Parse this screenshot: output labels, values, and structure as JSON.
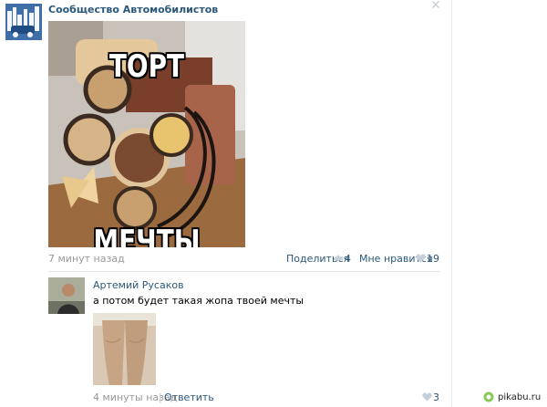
{
  "post": {
    "group_name": "Сообщество Автомобилистов",
    "close_glyph": "✕",
    "meme_top": "ТОРТ",
    "meme_bottom": "МЕЧТЫ",
    "timestamp": "7 минут назад",
    "share_label": "Поделиться",
    "share_count": "4",
    "like_label": "Мне нравится",
    "like_count": "19"
  },
  "comment": {
    "author": "Артемий Русаков",
    "text": "а потом будет такая жопа твоей мечты",
    "time": "4 минуты назад",
    "separator": "|",
    "reply_label": "Ответить",
    "like_count": "3"
  },
  "watermark": {
    "text": "pikabu.ru"
  },
  "colors": {
    "link": "#2b587a",
    "muted": "#999999",
    "icon": "#c5d0db",
    "divider": "#e7e8ec"
  },
  "icons": {
    "share": "megaphone-icon",
    "like": "heart-icon",
    "close": "close-icon"
  }
}
